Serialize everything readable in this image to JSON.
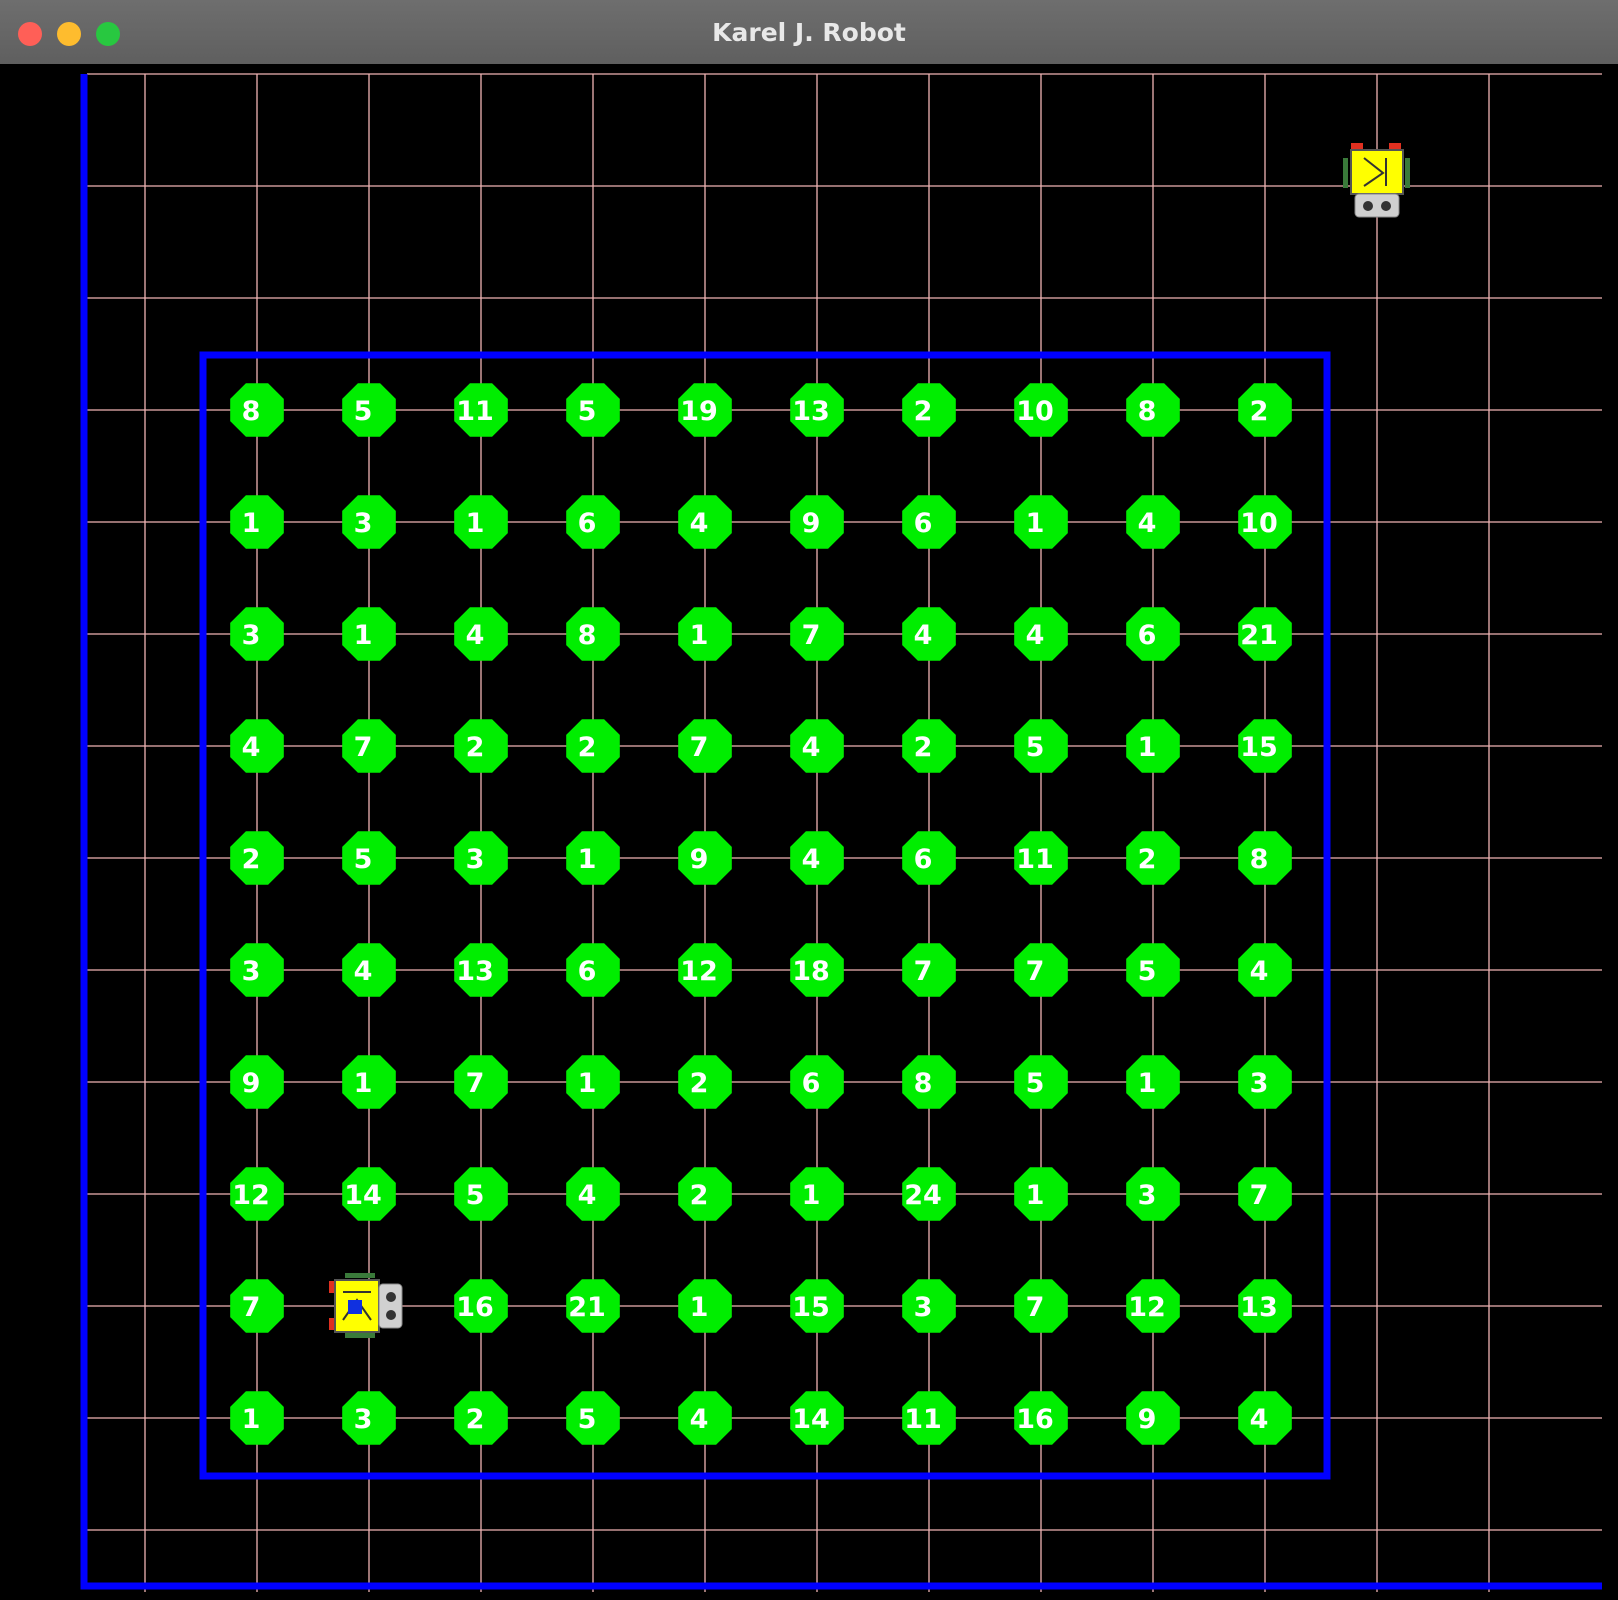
{
  "window": {
    "title": "Karel J. Robot",
    "buttons": [
      {
        "name": "close",
        "color": "#ff5f57"
      },
      {
        "name": "minimize",
        "color": "#febc2e"
      },
      {
        "name": "zoom",
        "color": "#28c840"
      }
    ]
  },
  "colors": {
    "background": "#000000",
    "grid_line": "#f0b4b4",
    "wall": "#0000ff",
    "beeper": "#00ee00",
    "beeper_text": "#ffffff",
    "robot_body": "#ffff00"
  },
  "world": {
    "beeper_rows": [
      [
        8,
        5,
        11,
        5,
        19,
        13,
        2,
        10,
        8,
        2
      ],
      [
        1,
        3,
        1,
        6,
        4,
        9,
        6,
        1,
        4,
        10
      ],
      [
        3,
        1,
        4,
        8,
        1,
        7,
        4,
        4,
        6,
        21
      ],
      [
        4,
        7,
        2,
        2,
        7,
        4,
        2,
        5,
        1,
        15
      ],
      [
        2,
        5,
        3,
        1,
        9,
        4,
        6,
        11,
        2,
        8
      ],
      [
        3,
        4,
        13,
        6,
        12,
        18,
        7,
        7,
        5,
        4
      ],
      [
        9,
        1,
        7,
        1,
        2,
        6,
        8,
        5,
        1,
        3
      ],
      [
        12,
        14,
        5,
        4,
        2,
        1,
        24,
        1,
        3,
        7
      ],
      [
        7,
        null,
        16,
        21,
        1,
        15,
        3,
        7,
        12,
        13
      ],
      [
        1,
        3,
        2,
        5,
        4,
        14,
        11,
        16,
        9,
        4
      ]
    ],
    "robots": [
      {
        "name": "robot-1",
        "facing": "south"
      },
      {
        "name": "robot-2",
        "facing": "east"
      }
    ]
  }
}
